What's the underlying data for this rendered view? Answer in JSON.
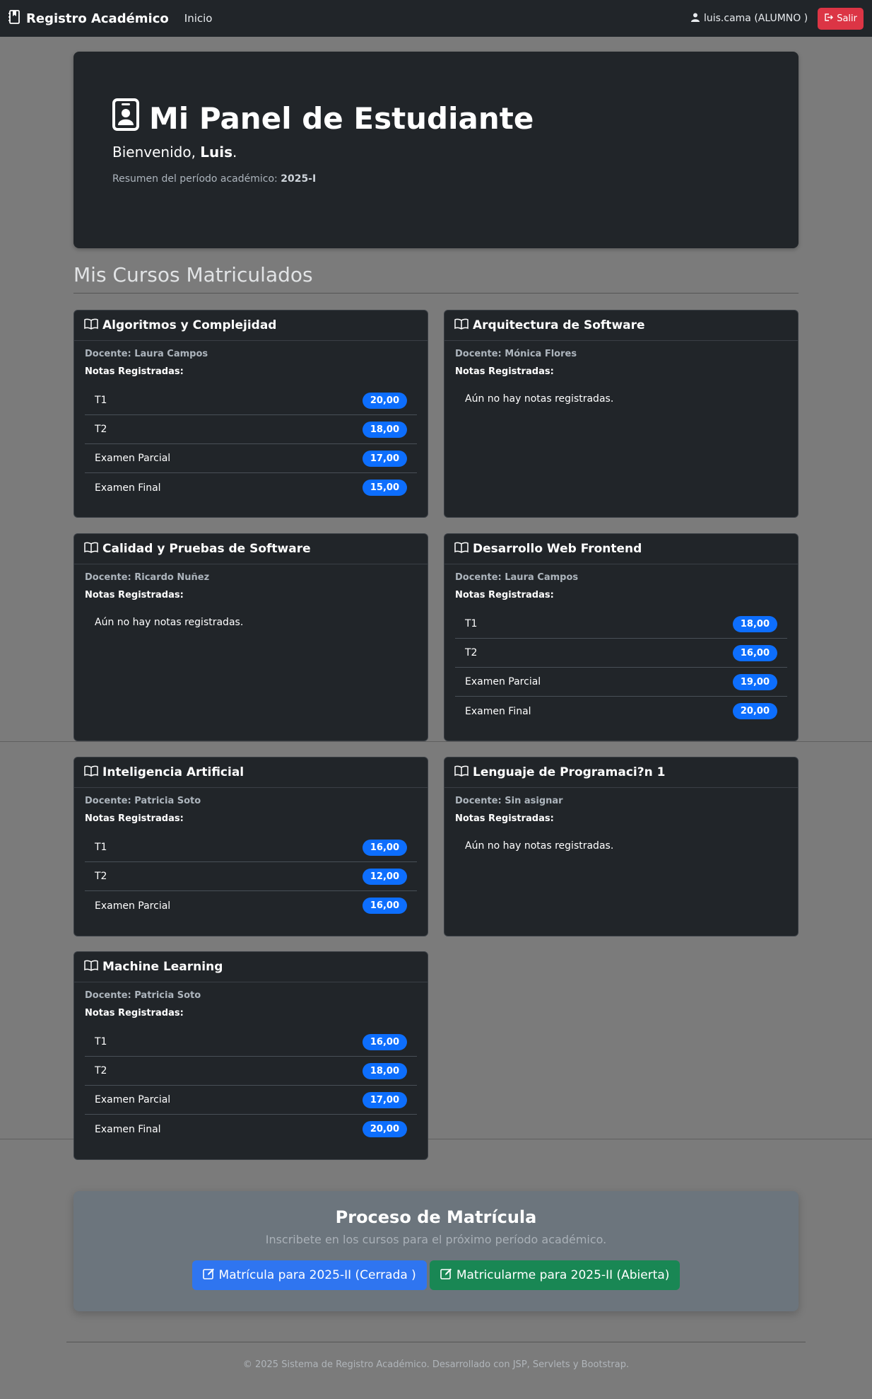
{
  "navbar": {
    "brand": "Registro Académico",
    "nav_inicio": "Inicio",
    "user_label": "luis.cama (ALUMNO )",
    "logout_label": "Salir"
  },
  "hero": {
    "title": "Mi Panel de Estudiante",
    "welcome_prefix": "Bienvenido, ",
    "welcome_name": "Luis",
    "welcome_suffix": ".",
    "period_prefix": "Resumen del período académico: ",
    "period_value": "2025-I"
  },
  "section": {
    "title": "Mis Cursos Matriculados"
  },
  "labels": {
    "notas": "Notas Registradas:",
    "no_notas": "Aún no hay notas registradas."
  },
  "courses": [
    {
      "title": "Algoritmos y Complejidad",
      "docente": "Docente: Laura Campos",
      "grades": [
        {
          "label": "T1",
          "value": "20,00"
        },
        {
          "label": "T2",
          "value": "18,00"
        },
        {
          "label": "Examen Parcial",
          "value": "17,00"
        },
        {
          "label": "Examen Final",
          "value": "15,00"
        }
      ]
    },
    {
      "title": "Arquitectura de Software",
      "docente": "Docente: Mónica Flores",
      "grades": []
    },
    {
      "title": "Calidad y Pruebas de Software",
      "docente": "Docente: Ricardo Nuñez",
      "grades": []
    },
    {
      "title": "Desarrollo Web Frontend",
      "docente": "Docente: Laura Campos",
      "grades": [
        {
          "label": "T1",
          "value": "18,00"
        },
        {
          "label": "T2",
          "value": "16,00"
        },
        {
          "label": "Examen Parcial",
          "value": "19,00"
        },
        {
          "label": "Examen Final",
          "value": "20,00"
        }
      ]
    },
    {
      "title": "Inteligencia Artificial",
      "docente": "Docente: Patricia Soto",
      "grades": [
        {
          "label": "T1",
          "value": "16,00"
        },
        {
          "label": "T2",
          "value": "12,00"
        },
        {
          "label": "Examen Parcial",
          "value": "16,00"
        }
      ]
    },
    {
      "title": "Lenguaje de Programaci?n 1",
      "docente": "Docente: Sin asignar",
      "grades": []
    },
    {
      "title": "Machine Learning",
      "docente": "Docente: Patricia Soto",
      "grades": [
        {
          "label": "T1",
          "value": "16,00"
        },
        {
          "label": "T2",
          "value": "18,00"
        },
        {
          "label": "Examen Parcial",
          "value": "17,00"
        },
        {
          "label": "Examen Final",
          "value": "20,00"
        }
      ]
    }
  ],
  "enroll": {
    "title": "Proceso de Matrícula",
    "subtitle": "Inscribete en los cursos para el próximo período académico.",
    "btn_closed": "Matrícula para 2025-II (Cerrada )",
    "btn_open": "Matricularme para 2025-II (Abierta)"
  },
  "footer": {
    "text": "© 2025 Sistema de Registro Académico. Desarrollado con JSP, Servlets y Bootstrap."
  },
  "colors": {
    "page_bg": "#7b7b7b",
    "card_bg": "#212529",
    "badge": "#0d6efd",
    "danger": "#dc3545",
    "success": "#198754",
    "primary": "#2f75f0"
  }
}
